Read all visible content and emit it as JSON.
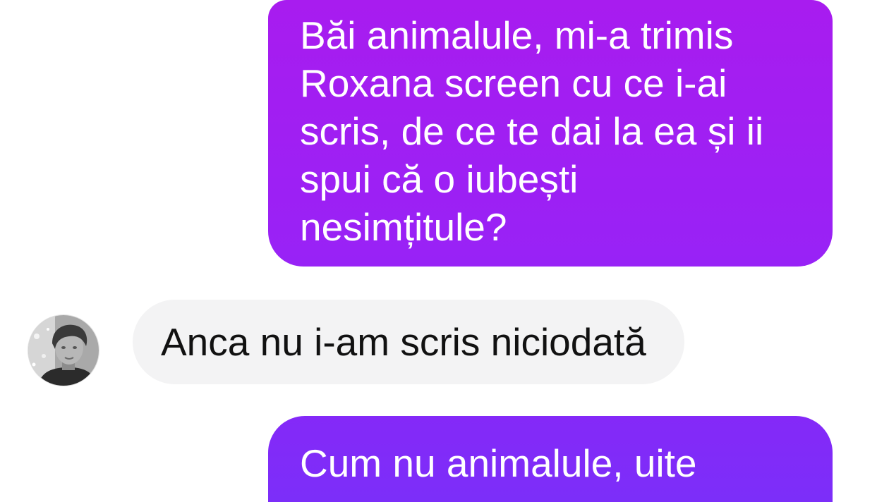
{
  "conversation": {
    "messages": [
      {
        "direction": "outgoing",
        "lines": [
          "Băi animalule, mi-a trimis",
          "Roxana screen cu ce i-ai",
          "scris, de ce te dai la ea și ii",
          "spui că o iubești",
          "nesimțitule?"
        ]
      },
      {
        "direction": "incoming",
        "lines": [
          "Anca nu i-am scris niciodată"
        ]
      },
      {
        "direction": "outgoing",
        "lines": [
          "Cum nu animalule, uite"
        ]
      }
    ]
  },
  "avatar": {
    "icon": "contact-profile-photo"
  },
  "colors": {
    "outgoing_gradient": [
      "#a81cef",
      "#9822f6",
      "#8429f8",
      "#7c2ef9"
    ],
    "outgoing_text": "#ffffff",
    "incoming_bubble": "#f3f3f4",
    "incoming_text": "#111111",
    "background": "#ffffff"
  }
}
